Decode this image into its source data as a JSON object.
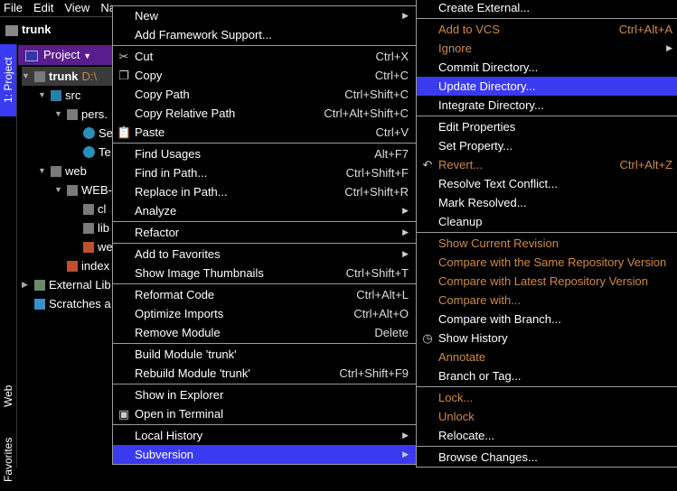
{
  "menubar": [
    "File",
    "Edit",
    "View",
    "Na"
  ],
  "navbar": {
    "title": "trunk"
  },
  "sidebar": {
    "project_tab": "1: Project",
    "web_tab": "Web",
    "favorites_tab": "Favorites"
  },
  "project": {
    "header": "Project",
    "tree": [
      {
        "label": "trunk",
        "extra": "D:\\",
        "indent": 0,
        "arrow": "▼",
        "icon": "folder",
        "bold": true
      },
      {
        "label": "src",
        "indent": 1,
        "arrow": "▼",
        "icon": "folder-blue"
      },
      {
        "label": "pers.",
        "indent": 2,
        "arrow": "▼",
        "icon": "package"
      },
      {
        "label": "Se",
        "indent": 3,
        "arrow": "",
        "icon": "class"
      },
      {
        "label": "Te",
        "indent": 3,
        "arrow": "",
        "icon": "class"
      },
      {
        "label": "web",
        "indent": 1,
        "arrow": "▼",
        "icon": "folder-web"
      },
      {
        "label": "WEB-",
        "indent": 2,
        "arrow": "▼",
        "icon": "folder"
      },
      {
        "label": "cl",
        "indent": 3,
        "arrow": "",
        "icon": "folder"
      },
      {
        "label": "lib",
        "indent": 3,
        "arrow": "",
        "icon": "folder"
      },
      {
        "label": "we",
        "indent": 3,
        "arrow": "",
        "icon": "xml"
      },
      {
        "label": "index",
        "indent": 2,
        "arrow": "",
        "icon": "html"
      },
      {
        "label": "External Lib",
        "indent": 0,
        "arrow": "▶",
        "icon": "library"
      },
      {
        "label": "Scratches a",
        "indent": 0,
        "arrow": "",
        "icon": "scratch"
      }
    ]
  },
  "context_menu": [
    {
      "label": "New",
      "submenu": true
    },
    {
      "label": "Add Framework Support..."
    },
    {
      "sep": true
    },
    {
      "label": "Cut",
      "shortcut": "Ctrl+X",
      "icon": "✂"
    },
    {
      "label": "Copy",
      "shortcut": "Ctrl+C",
      "icon": "❐"
    },
    {
      "label": "Copy Path",
      "shortcut": "Ctrl+Shift+C"
    },
    {
      "label": "Copy Relative Path",
      "shortcut": "Ctrl+Alt+Shift+C"
    },
    {
      "label": "Paste",
      "shortcut": "Ctrl+V",
      "icon": "📋"
    },
    {
      "sep": true
    },
    {
      "label": "Find Usages",
      "shortcut": "Alt+F7"
    },
    {
      "label": "Find in Path...",
      "shortcut": "Ctrl+Shift+F"
    },
    {
      "label": "Replace in Path...",
      "shortcut": "Ctrl+Shift+R"
    },
    {
      "label": "Analyze",
      "submenu": true
    },
    {
      "sep": true
    },
    {
      "label": "Refactor",
      "submenu": true
    },
    {
      "sep": true
    },
    {
      "label": "Add to Favorites",
      "submenu": true
    },
    {
      "label": "Show Image Thumbnails",
      "shortcut": "Ctrl+Shift+T"
    },
    {
      "sep": true
    },
    {
      "label": "Reformat Code",
      "shortcut": "Ctrl+Alt+L"
    },
    {
      "label": "Optimize Imports",
      "shortcut": "Ctrl+Alt+O"
    },
    {
      "label": "Remove Module",
      "shortcut": "Delete"
    },
    {
      "sep": true
    },
    {
      "label": "Build Module 'trunk'"
    },
    {
      "label": "Rebuild Module 'trunk'",
      "shortcut": "Ctrl+Shift+F9"
    },
    {
      "sep": true
    },
    {
      "label": "Show in Explorer"
    },
    {
      "label": "Open in Terminal",
      "icon": "▣"
    },
    {
      "sep": true
    },
    {
      "label": "Local History",
      "submenu": true
    },
    {
      "label": "Subversion",
      "submenu": true,
      "highlighted": true
    }
  ],
  "subversion_menu": [
    {
      "label": "Create External..."
    },
    {
      "sep": true
    },
    {
      "label": "Add to VCS",
      "shortcut": "Ctrl+Alt+A",
      "orange": true
    },
    {
      "label": "Ignore",
      "submenu": true,
      "orange": true
    },
    {
      "label": "Commit Directory..."
    },
    {
      "label": "Update Directory...",
      "highlighted": true
    },
    {
      "label": "Integrate Directory..."
    },
    {
      "sep": true
    },
    {
      "label": "Edit Properties"
    },
    {
      "label": "Set Property..."
    },
    {
      "label": "Revert...",
      "shortcut": "Ctrl+Alt+Z",
      "orange": true,
      "icon": "↶"
    },
    {
      "label": "Resolve Text Conflict..."
    },
    {
      "label": "Mark Resolved..."
    },
    {
      "label": "Cleanup"
    },
    {
      "sep": true
    },
    {
      "label": "Show Current Revision",
      "orange": true
    },
    {
      "label": "Compare with the Same Repository Version",
      "orange": true
    },
    {
      "label": "Compare with Latest Repository Version",
      "orange": true
    },
    {
      "label": "Compare with...",
      "orange": true
    },
    {
      "label": "Compare with Branch..."
    },
    {
      "label": "Show History",
      "icon": "◷"
    },
    {
      "label": "Annotate",
      "orange": true
    },
    {
      "label": "Branch or Tag..."
    },
    {
      "sep": true
    },
    {
      "label": "Lock...",
      "orange": true
    },
    {
      "label": "Unlock",
      "orange": true
    },
    {
      "label": "Relocate..."
    },
    {
      "sep": true
    },
    {
      "label": "Browse Changes..."
    }
  ]
}
